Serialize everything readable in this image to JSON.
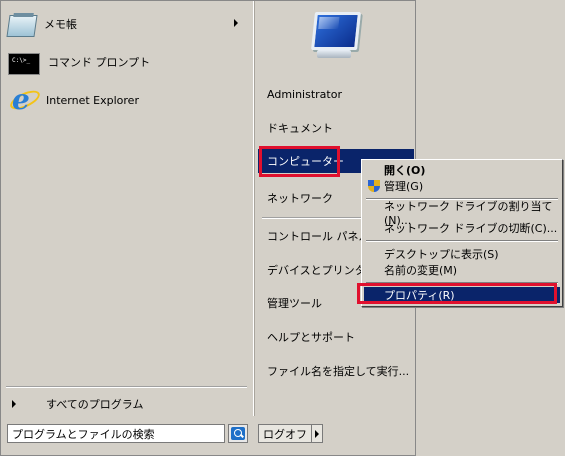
{
  "programs": [
    {
      "label": "メモ帳",
      "icon": "notepad-icon",
      "has_submenu": true
    },
    {
      "label": "コマンド プロンプト",
      "icon": "command-prompt-icon",
      "icon_text": "C:\\>_"
    },
    {
      "label": "Internet Explorer",
      "icon": "internet-explorer-icon"
    }
  ],
  "all_programs_label": "すべてのプログラム",
  "search": {
    "placeholder": "プログラムとファイルの検索",
    "value": "プログラムとファイルの検索"
  },
  "logoff_label": "ログオフ",
  "right_items": [
    "Administrator",
    "ドキュメント",
    "コンピューター",
    "ネットワーク",
    "コントロール パネル",
    "デバイスとプリンター",
    "管理ツール",
    "ヘルプとサポート",
    "ファイル名を指定して実行..."
  ],
  "context_menu": {
    "open": "開く(O)",
    "manage": "管理(G)",
    "map_drive": "ネットワーク ドライブの割り当て(N)...",
    "disconnect_drive": "ネットワーク ドライブの切断(C)...",
    "show_desktop": "デスクトップに表示(S)",
    "rename": "名前の変更(M)",
    "properties": "プロパティ(R)"
  },
  "colors": {
    "highlight_bg": "#0a246a",
    "annotation_red": "#e0102e",
    "menu_bg": "#d4d0c8"
  }
}
